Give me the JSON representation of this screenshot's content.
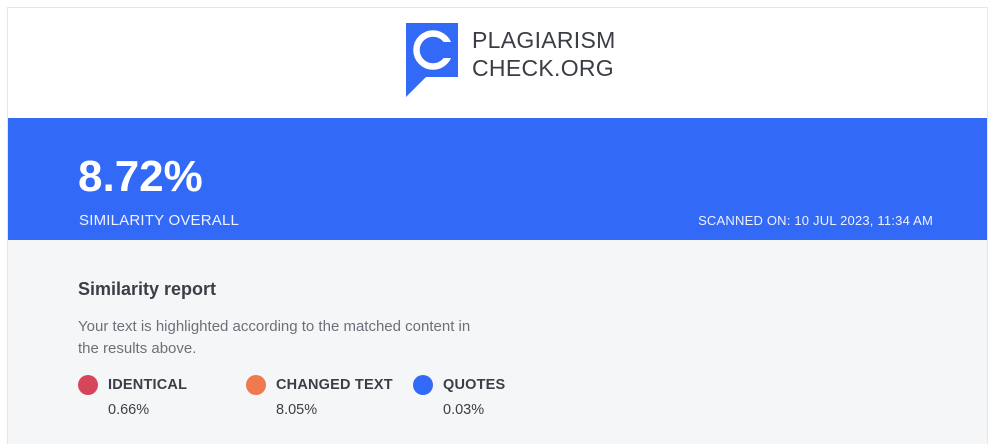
{
  "brand": {
    "line1": "PLAGIARISM",
    "line2": "CHECK.ORG",
    "logo_letter": "C",
    "logo_color": "#3369f7"
  },
  "summary": {
    "similarity_value": "8.72%",
    "similarity_label": "SIMILARITY OVERALL",
    "scanned_on": "SCANNED ON: 10 JUL 2023, 11:34 AM",
    "band_color": "#3369f7"
  },
  "report": {
    "title": "Similarity report",
    "description": "Your text is highlighted according to the matched content in the results above.",
    "legend": [
      {
        "label": "IDENTICAL",
        "value": "0.66%",
        "color": "#d5465a"
      },
      {
        "label": "CHANGED TEXT",
        "value": "8.05%",
        "color": "#ee7a4d"
      },
      {
        "label": "QUOTES",
        "value": "0.03%",
        "color": "#3369f7"
      }
    ]
  }
}
